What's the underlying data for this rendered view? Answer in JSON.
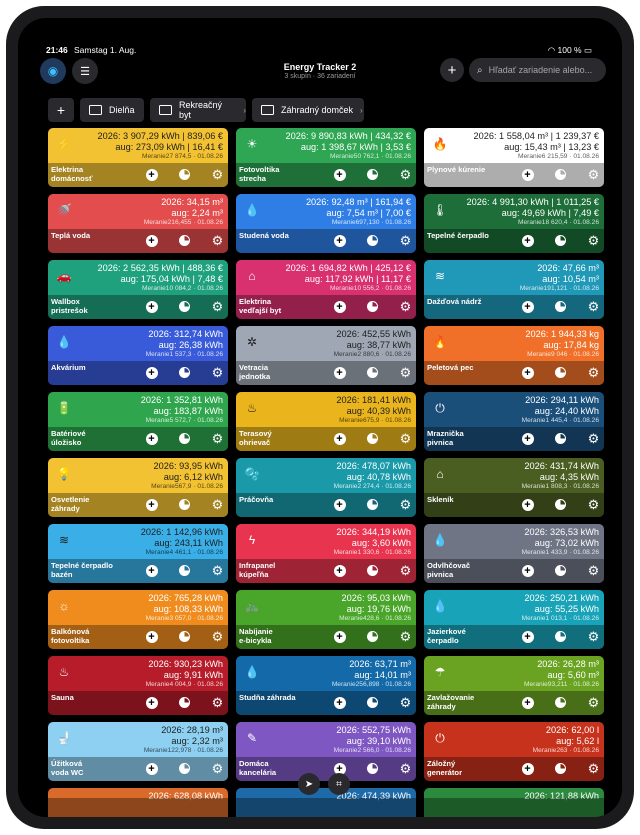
{
  "status": {
    "time": "21:46",
    "date": "Samstag 1. Aug.",
    "battery": "100 %"
  },
  "header": {
    "title": "Energy Tracker 2",
    "subtitle": "3 skupín · 36 zariadení",
    "search_placeholder": "Hľadať zariadenie alebo..."
  },
  "groups": [
    "Dielňa",
    "Rekreačný byt",
    "Záhradný domček"
  ],
  "cards": [
    {
      "name": "Elektrina\ndomácnosť",
      "icon": "lightning-icon",
      "glyph": "⚡",
      "color": "#f2c233",
      "dark": true,
      "l1": "2026:  3 907,29 kWh | 839,06 €",
      "l2": "aug:  273,09 kWh |  16,41 €",
      "meta": "Meranie27 874,5 · 01.08.26"
    },
    {
      "name": "Fotovoltika\nstrecha",
      "icon": "sun-icon",
      "glyph": "☀",
      "color": "#2ea653",
      "dark": false,
      "l1": "2026:  9 890,83 kWh | 434,32 €",
      "l2": "aug:  1 398,67 kWh |  3,53 €",
      "meta": "Meranie50 762,1 · 01.08.26"
    },
    {
      "name": "Plynové kúrenie",
      "icon": "flame-icon",
      "glyph": "🔥",
      "color": "#ffffff",
      "dark": true,
      "l1": "2026:  1 558,04 m³ | 1 239,37 €",
      "l2": "aug:  15,43 m³ |  13,23 €",
      "meta": "Meranie6 215,59 · 01.08.26"
    },
    {
      "name": "Teplá voda",
      "icon": "shower-icon",
      "glyph": "🚿",
      "color": "#e34d4d",
      "dark": false,
      "l1": "34,15 m³",
      "l2": "2,24 m³",
      "meta": "Meranie216,455 · 01.08.26",
      "y1": "2026:",
      "y2": "aug:"
    },
    {
      "name": "Studená voda",
      "icon": "water-drops-icon",
      "glyph": "💧",
      "color": "#2f7ee6",
      "dark": false,
      "l1": "2026:  92,48 m³ | 161,94 €",
      "l2": "aug:  7,54 m³ |  7,00 €",
      "meta": "Meranie697,130 · 01.08.26"
    },
    {
      "name": "Tepelné čerpadlo",
      "icon": "thermometer-icon",
      "glyph": "🌡",
      "color": "#1d6e38",
      "dark": false,
      "l1": "2026:  4 991,30 kWh | 1 011,25 €",
      "l2": "aug:  49,69 kWh |  7,49 €",
      "meta": "Meranie18 620,4 · 01.08.26"
    },
    {
      "name": "Wallbox\npristrešok",
      "icon": "car-icon",
      "glyph": "🚗",
      "color": "#1fa17e",
      "dark": false,
      "l1": "2026:  2 562,35 kWh | 488,36 €",
      "l2": "aug:  175,04 kWh |  7,48 €",
      "meta": "Meranie10 084,2 · 01.08.26"
    },
    {
      "name": "Elektrina\nvedľajší byt",
      "icon": "house-icon",
      "glyph": "⌂",
      "color": "#d9306f",
      "dark": false,
      "l1": "2026:  1 694,82 kWh | 425,12 €",
      "l2": "aug:  117,92 kWh |  11,17 €",
      "meta": "Meranie10 556,2 · 01.08.26"
    },
    {
      "name": "Dažďová nádrž",
      "icon": "waves-icon",
      "glyph": "≋",
      "color": "#2098b8",
      "dark": false,
      "l1": "47,66 m³",
      "l2": "10,54 m³",
      "meta": "Meranie191,121 · 01.08.26",
      "y1": "2026:",
      "y2": "aug:"
    },
    {
      "name": "Akvárium",
      "icon": "drop-icon",
      "glyph": "💧",
      "color": "#3a5bd9",
      "dark": false,
      "l1": "312,74 kWh",
      "l2": "26,38 kWh",
      "meta": "Meranie1 537,3 · 01.08.26",
      "y1": "2026:",
      "y2": "aug:"
    },
    {
      "name": "Vetracia\njednotka",
      "icon": "fan-icon",
      "glyph": "✲",
      "color": "#9ea7b3",
      "dark": true,
      "l1": "452,55 kWh",
      "l2": "38,77 kWh",
      "meta": "Meranie2 880,6 · 01.08.26",
      "y1": "2026:",
      "y2": "aug:"
    },
    {
      "name": "Peletová pec",
      "icon": "fire-icon",
      "glyph": "🔥",
      "color": "#f0702a",
      "dark": false,
      "l1": "1 944,33 kg",
      "l2": "17,84 kg",
      "meta": "Meranie9 046 · 01.08.26",
      "y1": "2026:",
      "y2": "aug:"
    },
    {
      "name": "Batériové\núložisko",
      "icon": "battery-icon",
      "glyph": "🔋",
      "color": "#2fa64d",
      "dark": false,
      "l1": "1 352,81 kWh",
      "l2": "183,87 kWh",
      "meta": "Meranie5 572,7 · 01.08.26",
      "y1": "2026:",
      "y2": "aug:"
    },
    {
      "name": "Terasový\nohrievač",
      "icon": "heater-icon",
      "glyph": "♨",
      "color": "#eab51c",
      "dark": true,
      "l1": "181,41 kWh",
      "l2": "40,39 kWh",
      "meta": "Meranie675,9 · 01.08.26",
      "y1": "2026:",
      "y2": "aug:"
    },
    {
      "name": "Mraznička\npivnica",
      "icon": "plug-icon",
      "glyph": "⏻",
      "color": "#1a4f7a",
      "dark": false,
      "l1": "294,11 kWh",
      "l2": "24,40 kWh",
      "meta": "Meranie1 445,4 · 01.08.26",
      "y1": "2026:",
      "y2": "aug:"
    },
    {
      "name": "Osvetlenie\nzáhrady",
      "icon": "lightbulb-icon",
      "glyph": "💡",
      "color": "#f2c233",
      "dark": true,
      "l1": "93,95 kWh",
      "l2": "6,12 kWh",
      "meta": "Meranie567,9 · 01.08.26",
      "y1": "2026:",
      "y2": "aug:"
    },
    {
      "name": "Práčovňa",
      "icon": "washer-icon",
      "glyph": "🫧",
      "color": "#1a9aa8",
      "dark": false,
      "l1": "478,07 kWh",
      "l2": "40,78 kWh",
      "meta": "Meranie2 274,4 · 01.08.26",
      "y1": "2026:",
      "y2": "aug:"
    },
    {
      "name": "Skleník",
      "icon": "lamp-icon",
      "glyph": "⌂",
      "color": "#4a5e22",
      "dark": false,
      "l1": "431,74 kWh",
      "l2": "4,35 kWh",
      "meta": "Meranie1 808,3 · 01.08.26",
      "y1": "2026:",
      "y2": "aug:"
    },
    {
      "name": "Tepelné čerpadlo\nbazén",
      "icon": "pool-icon",
      "glyph": "≋",
      "color": "#3aaee6",
      "dark": true,
      "l1": "1 142,96 kWh",
      "l2": "243,11 kWh",
      "meta": "Meranie4 461,1 · 01.08.26",
      "y1": "2026:",
      "y2": "aug:"
    },
    {
      "name": "Infrapanel\nkúpeľňa",
      "icon": "bolt-icon",
      "glyph": "ϟ",
      "color": "#e8344f",
      "dark": false,
      "l1": "344,19 kWh",
      "l2": "3,60 kWh",
      "meta": "Meranie1 330,6 · 01.08.26",
      "y1": "2026:",
      "y2": "aug:"
    },
    {
      "name": "Odvlhčovač\npivnica",
      "icon": "drops-icon",
      "glyph": "💧",
      "color": "#6f7584",
      "dark": false,
      "l1": "326,53 kWh",
      "l2": "73,02 kWh",
      "meta": "Meranie1 433,9 · 01.08.26",
      "y1": "2026:",
      "y2": "aug:"
    },
    {
      "name": "Balkónová\nfotovoltika",
      "icon": "solar-panel-icon",
      "glyph": "☼",
      "color": "#f08c1e",
      "dark": false,
      "l1": "765,28 kWh",
      "l2": "108,33 kWh",
      "meta": "Meranie3 057,0 · 01.08.26",
      "y1": "2026:",
      "y2": "aug:"
    },
    {
      "name": "Nabíjanie\ne-bicykla",
      "icon": "bicycle-icon",
      "glyph": "🚲",
      "color": "#4aa62a",
      "dark": false,
      "l1": "95,03 kWh",
      "l2": "19,76 kWh",
      "meta": "Meranie428,6 · 01.08.26",
      "y1": "2026:",
      "y2": "aug:"
    },
    {
      "name": "Jazierkové\nčerpadlo",
      "icon": "water-drop-icon",
      "glyph": "💧",
      "color": "#18a3b8",
      "dark": false,
      "l1": "250,21 kWh",
      "l2": "55,25 kWh",
      "meta": "Meranie1 013,1 · 01.08.26",
      "y1": "2026:",
      "y2": "aug:"
    },
    {
      "name": "Sauna",
      "icon": "sauna-icon",
      "glyph": "♨",
      "color": "#b71c2a",
      "dark": false,
      "l1": "930,23 kWh",
      "l2": "9,91 kWh",
      "meta": "Meranie4 004,9 · 01.08.26",
      "y1": "2026:",
      "y2": "aug:"
    },
    {
      "name": "Studňa záhrada",
      "icon": "well-drops-icon",
      "glyph": "💧",
      "color": "#146aa8",
      "dark": false,
      "l1": "63,71 m³",
      "l2": "14,01 m³",
      "meta": "Meranie256,898 · 01.08.26",
      "y1": "2026:",
      "y2": "aug:"
    },
    {
      "name": "Zavlažovanie\nzáhrady",
      "icon": "sprinkler-icon",
      "glyph": "☂",
      "color": "#6aa322",
      "dark": false,
      "l1": "26,28 m³",
      "l2": "5,60 m³",
      "meta": "Meranie93,211 · 01.08.26",
      "y1": "2026:",
      "y2": "aug:"
    },
    {
      "name": "Úžitková\nvoda WC",
      "icon": "toilet-icon",
      "glyph": "🚽",
      "color": "#8ed0f2",
      "dark": true,
      "l1": "28,19 m³",
      "l2": "2,32 m³",
      "meta": "Meranie122,978 · 01.08.26",
      "y1": "2026:",
      "y2": "aug:"
    },
    {
      "name": "Domáca\nkancelária",
      "icon": "office-icon",
      "glyph": "✎",
      "color": "#7e57c2",
      "dark": false,
      "l1": "552,75 kWh",
      "l2": "39,10 kWh",
      "meta": "Meranie2 566,0 · 01.08.26",
      "y1": "2026:",
      "y2": "aug:"
    },
    {
      "name": "Záložný\ngenerátor",
      "icon": "power-icon",
      "glyph": "⏻",
      "color": "#c7321c",
      "dark": false,
      "l1": "62,00 l",
      "l2": "5,62 l",
      "meta": "Meranie263 · 01.08.26",
      "y1": "2026:",
      "y2": "aug:"
    },
    {
      "name": "",
      "icon": "",
      "glyph": "",
      "color": "#d96a2a",
      "dark": false,
      "l1": "628,08 kWh",
      "l2": "",
      "meta": "",
      "y1": "2026:",
      "y2": ""
    },
    {
      "name": "",
      "icon": "",
      "glyph": "",
      "color": "#1e6aa8",
      "dark": false,
      "l1": "474,39 kWh",
      "l2": "",
      "meta": "",
      "y1": "2026:",
      "y2": ""
    },
    {
      "name": "",
      "icon": "",
      "glyph": "",
      "color": "#2c8a3e",
      "dark": false,
      "l1": "121,88 kWh",
      "l2": "",
      "meta": "",
      "y1": "2026:",
      "y2": ""
    }
  ]
}
